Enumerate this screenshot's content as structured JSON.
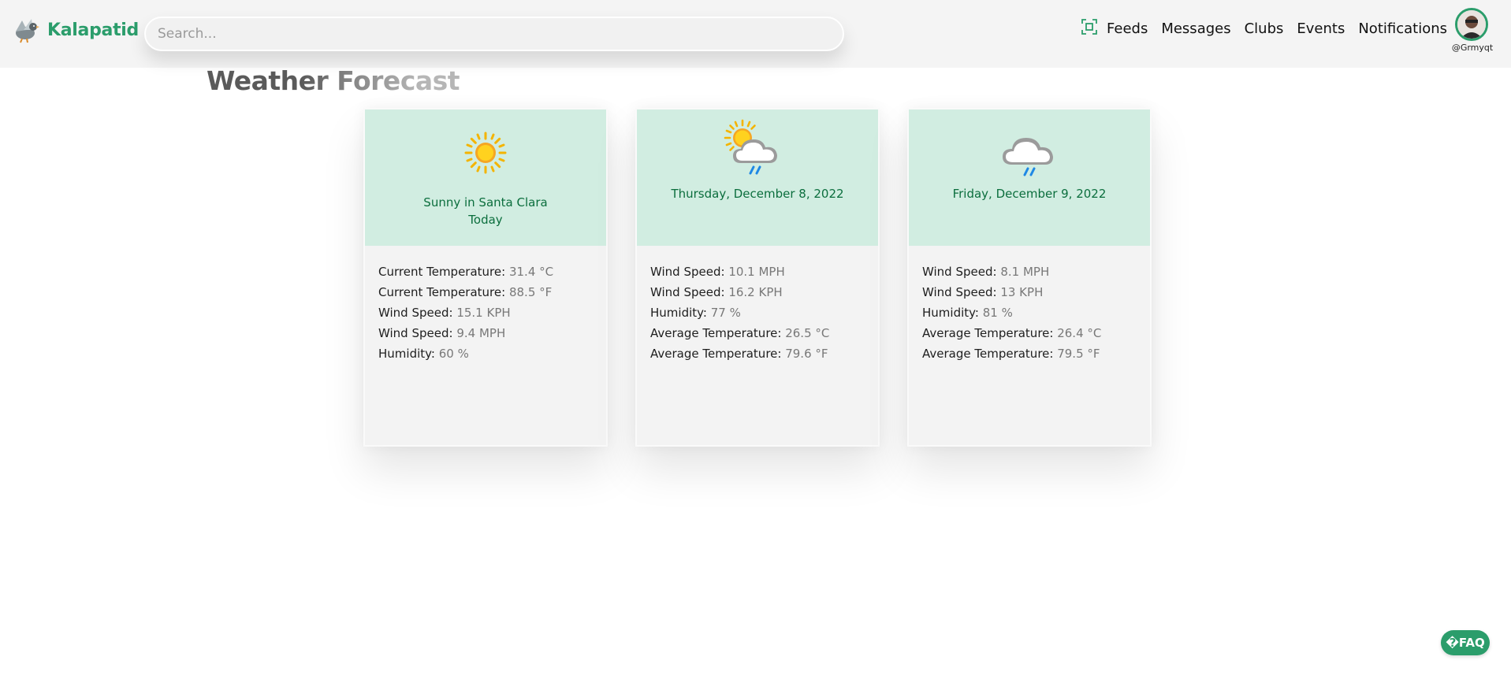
{
  "brand": {
    "name": "Kalapatid"
  },
  "search": {
    "placeholder": "Search..."
  },
  "nav": {
    "icon": "qr-scan-icon",
    "items": [
      "Feeds",
      "Messages",
      "Clubs",
      "Events",
      "Notifications"
    ]
  },
  "user": {
    "handle": "@Grmyqt"
  },
  "page": {
    "title": "Weather Forecast"
  },
  "cards": [
    {
      "icon": "sun-icon",
      "head_line1": "Sunny in Santa Clara",
      "head_line2": "Today",
      "rows": [
        {
          "label": "Current Temperature:",
          "value": "31.4 °C"
        },
        {
          "label": "Current Temperature:",
          "value": "88.5 °F"
        },
        {
          "label": "Wind Speed:",
          "value": "15.1 KPH"
        },
        {
          "label": "Wind Speed:",
          "value": "9.4 MPH"
        },
        {
          "label": "Humidity:",
          "value": "60 %"
        }
      ]
    },
    {
      "icon": "sun-behind-rain-cloud-icon",
      "head_line1": "Thursday, December 8, 2022",
      "rows": [
        {
          "label": "Wind Speed:",
          "value": "10.1 MPH"
        },
        {
          "label": "Wind Speed:",
          "value": "16.2 KPH"
        },
        {
          "label": "Humidity:",
          "value": "77 %"
        },
        {
          "label": "Average Temperature:",
          "value": "26.5 °C"
        },
        {
          "label": "Average Temperature:",
          "value": "79.6 °F"
        }
      ]
    },
    {
      "icon": "rain-cloud-icon",
      "head_line1": "Friday, December 9, 2022",
      "rows": [
        {
          "label": "Wind Speed:",
          "value": "8.1 MPH"
        },
        {
          "label": "Wind Speed:",
          "value": "13 KPH"
        },
        {
          "label": "Humidity:",
          "value": "81 %"
        },
        {
          "label": "Average Temperature:",
          "value": "26.4 °C"
        },
        {
          "label": "Average Temperature:",
          "value": "79.5 °F"
        }
      ]
    }
  ],
  "faq": {
    "label": "�FAQ"
  },
  "colors": {
    "brand": "#2b9d6b",
    "card_header": "#d1ede1",
    "card_heading_text": "#0b6e3d"
  }
}
